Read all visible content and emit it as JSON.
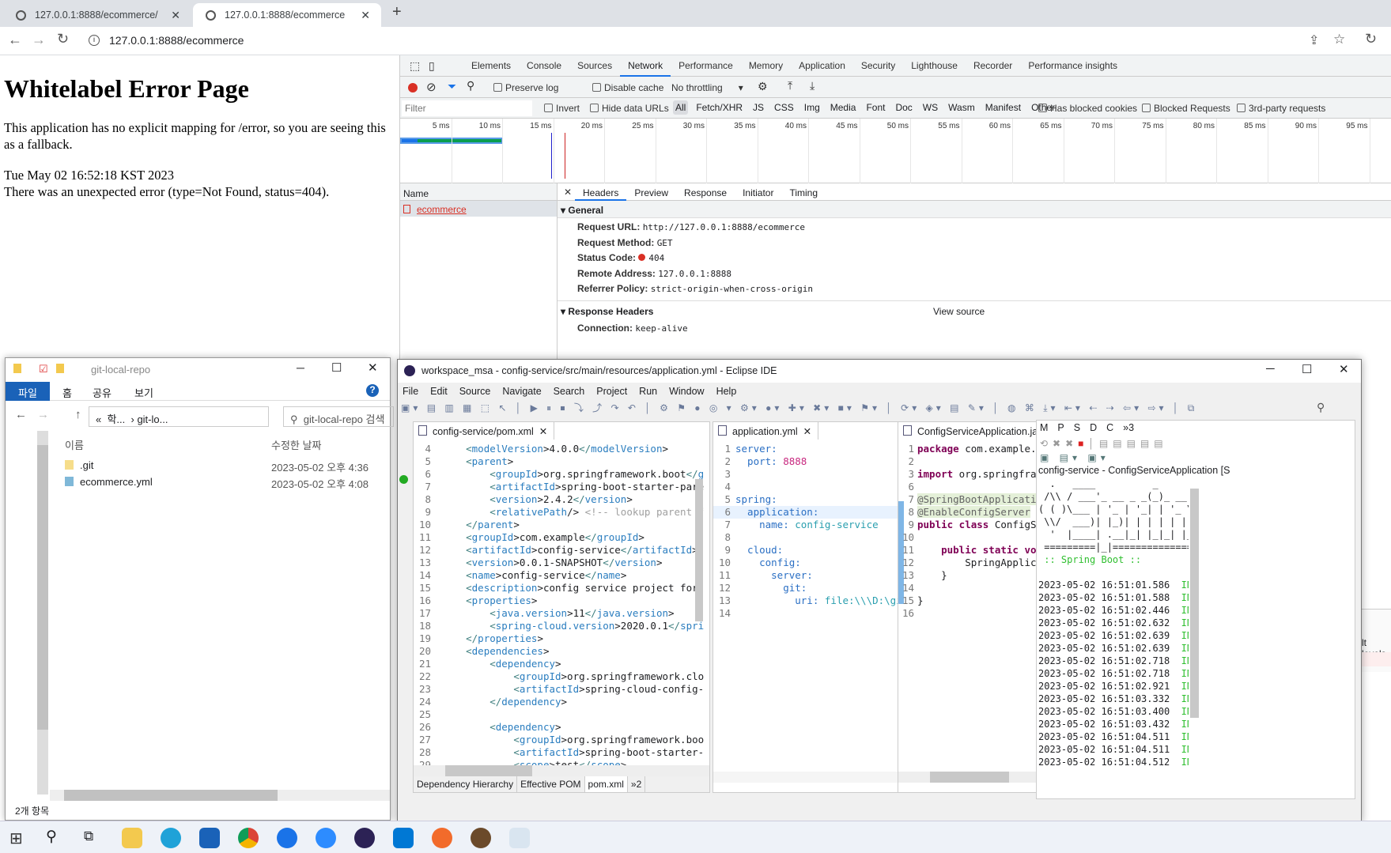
{
  "browser": {
    "tabs": [
      {
        "title": "127.0.0.1:8888/ecommerce/"
      },
      {
        "title": "127.0.0.1:8888/ecommerce"
      }
    ],
    "url": "127.0.0.1:8888/ecommerce"
  },
  "page": {
    "title": "Whitelabel Error Page",
    "message": "This application has no explicit mapping for /error, so you are seeing this as a fallback.",
    "timestamp": "Tue May 02 16:52:18 KST 2023",
    "error": "There was an unexpected error (type=Not Found, status=404)."
  },
  "devtools": {
    "tabs": [
      "Elements",
      "Console",
      "Sources",
      "Network",
      "Performance",
      "Memory",
      "Application",
      "Security",
      "Lighthouse",
      "Recorder",
      "Performance insights"
    ],
    "active_tab": "Network",
    "toolbar": {
      "preserve_log": "Preserve log",
      "disable_cache": "Disable cache",
      "throttling": "No throttling"
    },
    "filter": {
      "placeholder": "Filter",
      "invert": "Invert",
      "hide_data_urls": "Hide data URLs",
      "types": [
        "All",
        "Fetch/XHR",
        "JS",
        "CSS",
        "Img",
        "Media",
        "Font",
        "Doc",
        "WS",
        "Wasm",
        "Manifest",
        "Other"
      ],
      "has_blocked_cookies": "Has blocked cookies",
      "blocked_requests": "Blocked Requests",
      "third_party": "3rd-party requests"
    },
    "timeline_ticks": [
      "5 ms",
      "10 ms",
      "15 ms",
      "20 ms",
      "25 ms",
      "30 ms",
      "35 ms",
      "40 ms",
      "45 ms",
      "50 ms",
      "55 ms",
      "60 ms",
      "65 ms",
      "70 ms",
      "75 ms",
      "80 ms",
      "85 ms",
      "90 ms",
      "95 ms"
    ],
    "name_header": "Name",
    "request": "ecommerce",
    "detail_tabs": [
      "Headers",
      "Preview",
      "Response",
      "Initiator",
      "Timing"
    ],
    "general_title": "General",
    "general": [
      {
        "k": "Request URL:",
        "v": "http://127.0.0.1:8888/ecommerce"
      },
      {
        "k": "Request Method:",
        "v": "GET"
      },
      {
        "k": "Status Code:",
        "v": "404"
      },
      {
        "k": "Remote Address:",
        "v": "127.0.0.1:8888"
      },
      {
        "k": "Referrer Policy:",
        "v": "strict-origin-when-cross-origin"
      }
    ],
    "response_headers_title": "Response Headers",
    "view_source": "View source",
    "response_headers": [
      {
        "k": "Connection:",
        "v": "keep-alive"
      }
    ],
    "partial_text": "lt levels"
  },
  "explorer": {
    "title": "git-local-repo",
    "ribbon": [
      "파일",
      "홈",
      "공유",
      "보기"
    ],
    "path": [
      "학...",
      "git-lo..."
    ],
    "search_placeholder": "git-local-repo 검색",
    "columns": [
      "이름",
      "수정한 날짜"
    ],
    "files": [
      {
        "name": ".git",
        "date": "2023-05-02 오후 4:36"
      },
      {
        "name": "ecommerce.yml",
        "date": "2023-05-02 오후 4:08"
      }
    ],
    "status": "2개 항목"
  },
  "eclipse": {
    "title": "workspace_msa - config-service/src/main/resources/application.yml - Eclipse IDE",
    "menu": [
      "File",
      "Edit",
      "Source",
      "Navigate",
      "Search",
      "Project",
      "Run",
      "Window",
      "Help"
    ],
    "pom": {
      "tab": "config-service/pom.xml",
      "bottom_tabs": [
        "Dependency Hierarchy",
        "Effective POM",
        "pom.xml",
        "»2"
      ],
      "lines": [
        [
          4,
          "    <modelVersion>4.0.0</modelVersion>"
        ],
        [
          5,
          "    <parent>"
        ],
        [
          6,
          "        <groupId>org.springframework.boot</g"
        ],
        [
          7,
          "        <artifactId>spring-boot-starter-pare"
        ],
        [
          8,
          "        <version>2.4.2</version>"
        ],
        [
          9,
          "        <relativePath/> <!-- lookup parent f"
        ],
        [
          10,
          "    </parent>"
        ],
        [
          11,
          "    <groupId>com.example</groupId>"
        ],
        [
          12,
          "    <artifactId>config-service</artifactId>"
        ],
        [
          13,
          "    <version>0.0.1-SNAPSHOT</version>"
        ],
        [
          14,
          "    <name>config-service</name>"
        ],
        [
          15,
          "    <description>config service project for"
        ],
        [
          16,
          "    <properties>"
        ],
        [
          17,
          "        <java.version>11</java.version>"
        ],
        [
          18,
          "        <spring-cloud.version>2020.0.1</spri"
        ],
        [
          19,
          "    </properties>"
        ],
        [
          20,
          "    <dependencies>"
        ],
        [
          21,
          "        <dependency>"
        ],
        [
          22,
          "            <groupId>org.springframework.clo"
        ],
        [
          23,
          "            <artifactId>spring-cloud-config-"
        ],
        [
          24,
          "        </dependency>"
        ],
        [
          25,
          ""
        ],
        [
          26,
          "        <dependency>"
        ],
        [
          27,
          "            <groupId>org.springframework.boo"
        ],
        [
          28,
          "            <artifactId>spring-boot-starter-"
        ],
        [
          29,
          "            <scope>test</scope>"
        ],
        [
          30,
          "        </dependency>"
        ]
      ]
    },
    "yml": {
      "tab": "application.yml",
      "lines": [
        [
          1,
          "server:",
          "",
          ""
        ],
        [
          2,
          "  port: ",
          "8888",
          "num"
        ],
        [
          3,
          "",
          "",
          ""
        ],
        [
          4,
          "",
          "",
          ""
        ],
        [
          5,
          "spring:",
          "",
          ""
        ],
        [
          6,
          "  application:",
          "",
          ""
        ],
        [
          7,
          "    name: ",
          "config-service",
          "str"
        ],
        [
          8,
          "",
          "",
          ""
        ],
        [
          9,
          "  cloud:",
          "",
          ""
        ],
        [
          10,
          "    config:",
          "",
          ""
        ],
        [
          11,
          "      server:",
          "",
          ""
        ],
        [
          12,
          "        git:",
          "",
          ""
        ],
        [
          13,
          "          uri: ",
          "file:\\\\\\D:\\git-local-repo",
          "str"
        ],
        [
          14,
          "",
          "",
          ""
        ]
      ]
    },
    "java": {
      "tab": "ConfigServiceApplication.java",
      "lines": [
        [
          1,
          "package",
          " com.example.co"
        ],
        [
          2,
          "",
          ""
        ],
        [
          3,
          "import",
          " org.springframew"
        ],
        [
          6,
          "",
          ""
        ],
        [
          7,
          "@SpringBootApplication",
          ""
        ],
        [
          8,
          "@EnableConfigServer",
          ""
        ],
        [
          9,
          "public class",
          " ConfigServ"
        ],
        [
          10,
          "",
          ""
        ],
        [
          11,
          "    public static void",
          ""
        ],
        [
          12,
          "",
          "        SpringApplicat"
        ],
        [
          13,
          "",
          "    }"
        ],
        [
          14,
          "",
          ""
        ],
        [
          15,
          "",
          "}"
        ],
        [
          16,
          "",
          ""
        ]
      ]
    },
    "console": {
      "tabs": [
        "M",
        "P",
        "S",
        "D",
        "C",
        "»3"
      ],
      "title": "config-service - ConfigServiceApplication [S",
      "banner": [
        "  .   ____          _            __ _ _",
        " /\\\\ / ___'_ __ _ _(_)_ __  __ _ \\ \\ \\ \\",
        "( ( )\\___ | '_ | '_| | '_ \\/ _` | \\ \\ \\ \\",
        " \\\\/  ___)| |_)| | | | | || (_| |  ) ) ) )",
        "  '  |____| .__|_| |_|_| |_\\__, | / / / /",
        " =========|_|==============|___/=/_/_/_/"
      ],
      "boot_label": " :: Spring Boot ::",
      "logs": [
        "2023-05-02 16:51:01.586",
        "2023-05-02 16:51:01.588",
        "2023-05-02 16:51:02.446",
        "2023-05-02 16:51:02.632",
        "2023-05-02 16:51:02.639",
        "2023-05-02 16:51:02.639",
        "2023-05-02 16:51:02.718",
        "2023-05-02 16:51:02.718",
        "2023-05-02 16:51:02.921",
        "2023-05-02 16:51:03.332",
        "2023-05-02 16:51:03.400",
        "2023-05-02 16:51:03.432",
        "2023-05-02 16:51:04.511",
        "2023-05-02 16:51:04.511",
        "2023-05-02 16:51:04.512"
      ],
      "level": "INFO"
    }
  },
  "colors": {
    "accent": "#1a73e8",
    "error": "#d93025",
    "explorer_blue": "#1a62b8",
    "info_green": "#2fbf2f"
  }
}
